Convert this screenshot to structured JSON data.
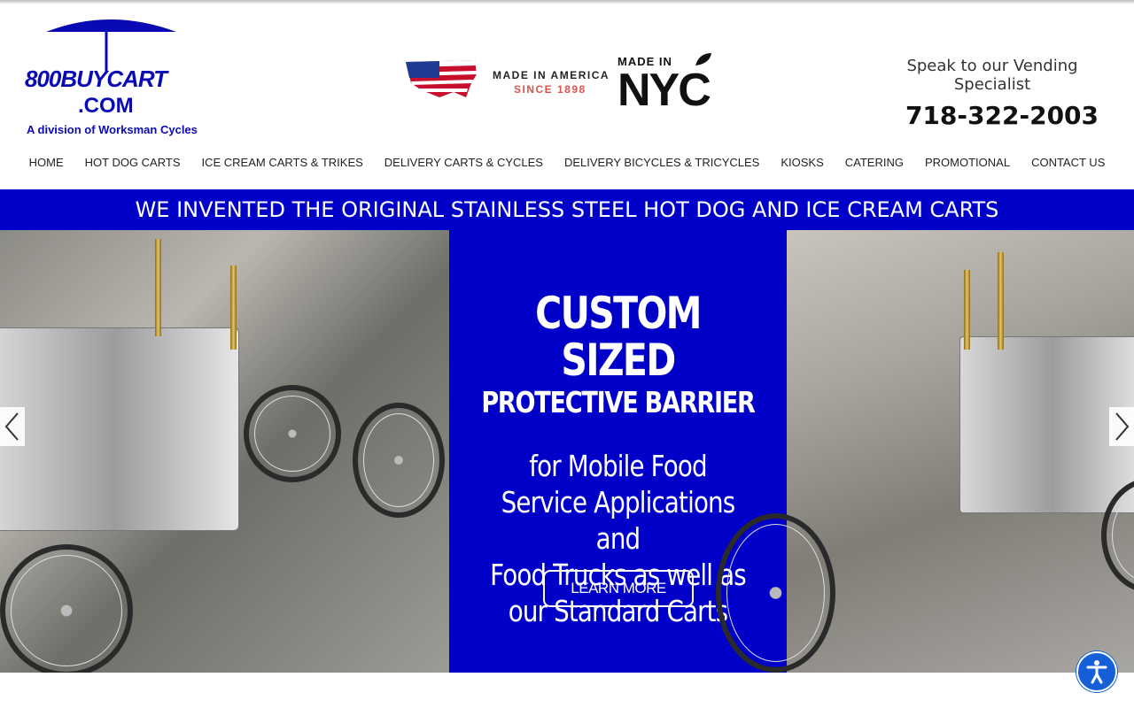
{
  "header": {
    "logo": {
      "name": "800BUYCART",
      "domain": ".COM",
      "division": "A division of Worksman Cycles"
    },
    "badges": {
      "usa_line1": "MADE IN AMERICA",
      "usa_line2": "SINCE 1898",
      "nyc_line1": "MADE IN",
      "nyc_line2": "NYC"
    },
    "contact": {
      "speak": "Speak to our Vending Specialist",
      "phone": "718-322-2003"
    }
  },
  "nav": {
    "items": [
      {
        "label": "HOME"
      },
      {
        "label": "HOT DOG CARTS"
      },
      {
        "label": "ICE CREAM CARTS & TRIKES"
      },
      {
        "label": "DELIVERY CARTS & CYCLES"
      },
      {
        "label": "DELIVERY BICYCLES & TRICYCLES"
      },
      {
        "label": "KIOSKS"
      },
      {
        "label": "CATERING"
      },
      {
        "label": "PROMOTIONAL"
      },
      {
        "label": "CONTACT US"
      }
    ]
  },
  "banner": {
    "text": "WE INVENTED THE ORIGINAL STAINLESS STEEL HOT DOG AND ICE CREAM CARTS"
  },
  "hero": {
    "title": "CUSTOM SIZED",
    "subtitle": "PROTECTIVE BARRIER",
    "body_lines": [
      "for Mobile Food",
      "Service Applications and",
      "Food Trucks as well as",
      "our Standard Carts"
    ],
    "button": "LEARN MORE"
  },
  "colors": {
    "brand_blue": "#0000c8",
    "logo_blue": "#0a0ab4",
    "accessibility_blue": "#1560d8"
  },
  "icons": {
    "slider_prev": "chevron-left-icon",
    "slider_next": "chevron-right-icon",
    "accessibility": "accessibility-icon"
  }
}
